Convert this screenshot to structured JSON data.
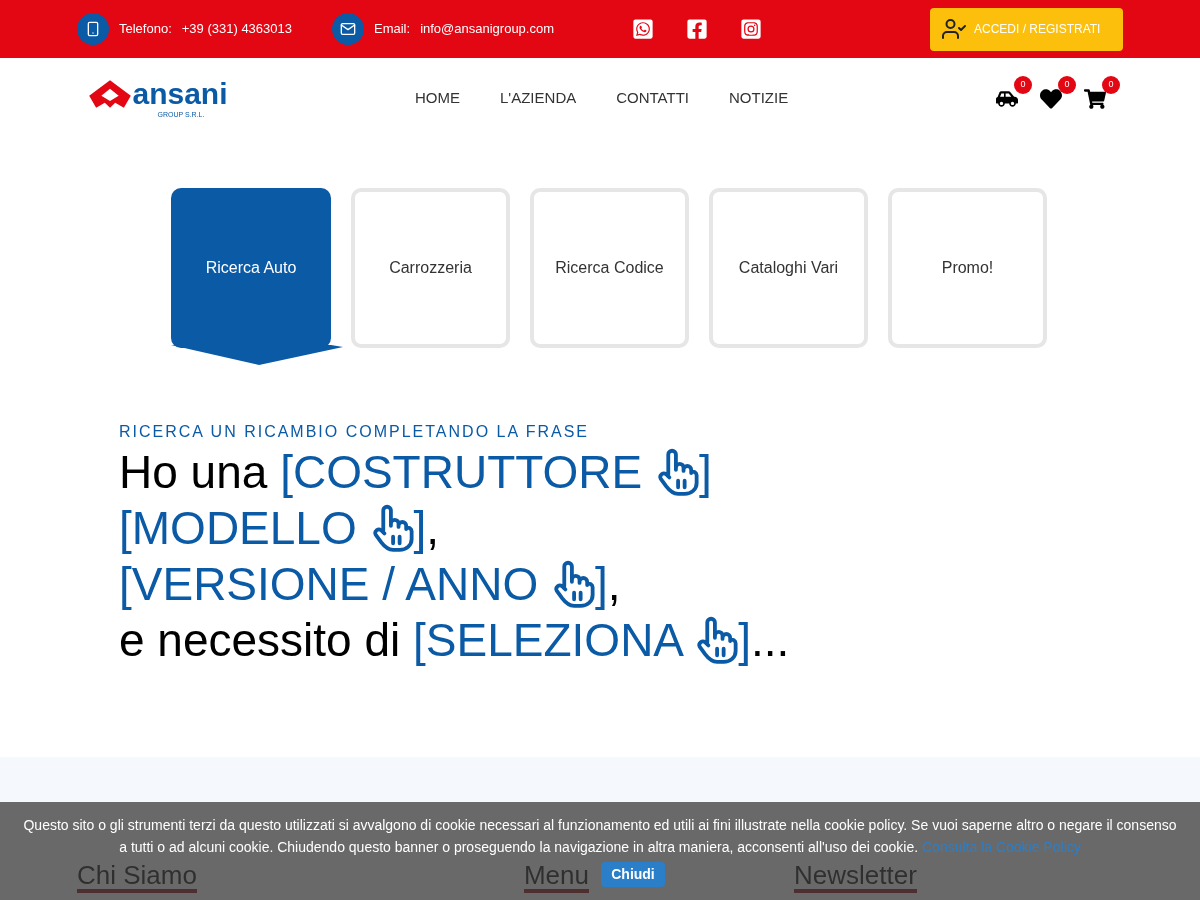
{
  "topbar": {
    "phone_label": "Telefono:",
    "phone": "+39 (331) 4363013",
    "email_label": "Email:",
    "email": "info@ansanigroup.com",
    "login": "ACCEDI / REGISTRATI"
  },
  "logo": {
    "name": "ansani",
    "sub": "GROUP S.R.L."
  },
  "nav": [
    {
      "label": "HOME"
    },
    {
      "label": "L'AZIENDA"
    },
    {
      "label": "CONTATTI"
    },
    {
      "label": "NOTIZIE"
    }
  ],
  "counters": [
    {
      "kind": "car",
      "count": "0"
    },
    {
      "kind": "heart",
      "count": "0"
    },
    {
      "kind": "cart",
      "count": "0"
    }
  ],
  "tabs": [
    {
      "label": "Ricerca Auto",
      "selected": true
    },
    {
      "label": "Carrozzeria",
      "selected": false
    },
    {
      "label": "Ricerca Codice",
      "selected": false
    },
    {
      "label": "Cataloghi Vari",
      "selected": false
    },
    {
      "label": "Promo!",
      "selected": false
    }
  ],
  "search": {
    "kicker": "RICERCA UN RICAMBIO COMPLETANDO LA FRASE",
    "lines": [
      {
        "prefix": "Ho una ",
        "selector": "[COSTRUTTORE",
        "close": "]"
      },
      {
        "selector": "[MODELLO",
        "close": "]",
        "suffix": ","
      },
      {
        "selector": "[VERSIONE / ANNO",
        "close": "]",
        "suffix": ","
      },
      {
        "prefix": "e necessito di ",
        "selector": "[SELEZIONA",
        "close": "]",
        "suffix": "..."
      }
    ]
  },
  "footer": {
    "headings": [
      "Chi Siamo",
      "Menu",
      "Newsletter"
    ]
  },
  "cookie_banner": {
    "text": "Questo sito o gli strumenti terzi da questo utilizzati si avvalgono di cookie necessari al funzionamento ed utili ai fini illustrate nella cookie policy. Se vuoi saperne altro o negare il consenso a tutti o ad alcuni cookie. Chiudendo questo banner o proseguendo la navigazione in altra maniera, acconsenti all'uso dei cookie.",
    "link": "Consulta la Cookie Policy",
    "button": "Chiudi"
  }
}
